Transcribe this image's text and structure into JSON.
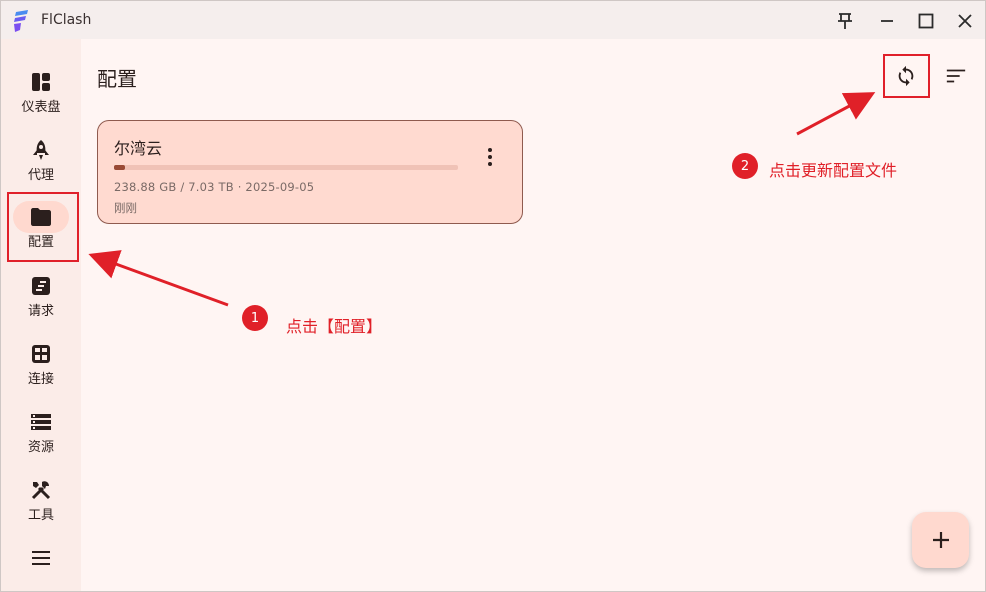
{
  "app": {
    "title": "FlClash",
    "icons": [
      "app-logo",
      "pin-icon",
      "minimize-icon",
      "maximize-icon",
      "close-icon"
    ]
  },
  "sidebar": {
    "items": [
      {
        "label": "仪表盘",
        "icon": "dashboard-icon"
      },
      {
        "label": "代理",
        "icon": "rocket-icon"
      },
      {
        "label": "配置",
        "icon": "folder-icon",
        "active": true
      },
      {
        "label": "请求",
        "icon": "request-icon"
      },
      {
        "label": "连接",
        "icon": "connections-icon"
      },
      {
        "label": "资源",
        "icon": "resources-icon"
      },
      {
        "label": "工具",
        "icon": "tools-icon"
      }
    ],
    "menu_icon": "hamburger-menu-icon"
  },
  "main": {
    "title": "配置",
    "actions": [
      "sync-icon",
      "sort-icon"
    ],
    "profiles": [
      {
        "name": "尔湾云",
        "usage": "238.88 GB / 7.03 TB · 2025-09-05",
        "updated": "刚刚",
        "progress_percent": 3.3
      }
    ],
    "fab_icon": "add-icon"
  },
  "annotations": [
    {
      "number": "1",
      "text": "点击【配置】"
    },
    {
      "number": "2",
      "text": "点击更新配置文件"
    }
  ],
  "colors": {
    "accent": "#9a4a35",
    "active_pill": "#ffd9cf",
    "card_bg": "#ffdad0",
    "annotation_red": "#e02028",
    "background": "#fff5f3",
    "sidebar_bg": "#fbece8"
  }
}
